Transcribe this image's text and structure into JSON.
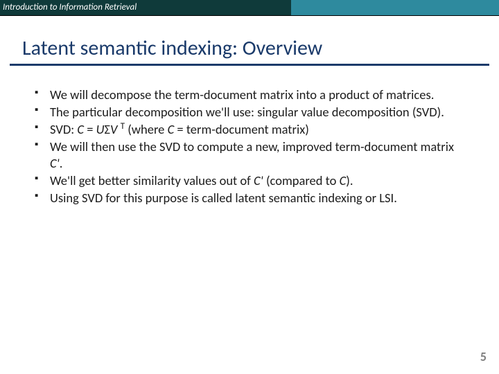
{
  "header": {
    "course": "Introduction to Information Retrieval"
  },
  "title": "Latent semantic indexing: Overview",
  "bullets": [
    {
      "html": "We will decompose the term-document matrix into a product of matrices."
    },
    {
      "html": "The particular decomposition we'll use: singular value decomposition (SVD)."
    },
    {
      "html": "SVD: <em class='ital'>C</em> = <em class='ital'>U</em>Σ<em class='ital'>V</em> <sup class='exp'>T</sup> (where <em class='ital'>C</em> = term-document matrix)"
    },
    {
      "html": "We will then use the SVD to compute a new, improved term-document matrix <em class='ital'>C'</em>."
    },
    {
      "html": "We'll get better similarity values out of <em class='ital'>C'</em> (compared to <em class='ital'>C</em>)."
    },
    {
      "html": "Using SVD for this purpose is called latent semantic indexing or LSI."
    }
  ],
  "page_number": "5"
}
